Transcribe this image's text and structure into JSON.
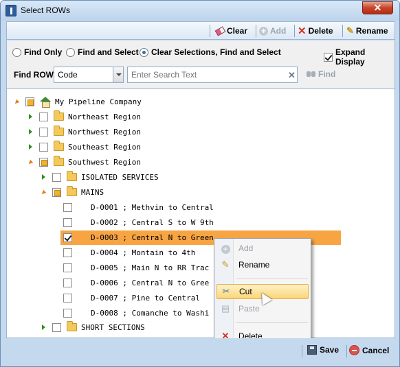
{
  "window": {
    "title": "Select ROWs",
    "close_glyph": "✕"
  },
  "toolbar": {
    "items": [
      {
        "label": "Clear",
        "icon": "eraser-icon",
        "enabled": true
      },
      {
        "label": "Add",
        "icon": "add-icon",
        "enabled": false
      },
      {
        "label": "Delete",
        "icon": "delete-icon",
        "enabled": true
      },
      {
        "label": "Rename",
        "icon": "pencil-icon",
        "enabled": true
      }
    ]
  },
  "options": {
    "radios": [
      {
        "label": "Find Only",
        "selected": false
      },
      {
        "label": "Find and Select",
        "selected": false
      },
      {
        "label": "Clear Selections, Find and Select",
        "selected": true
      }
    ],
    "expand_display": {
      "label": "Expand Display",
      "checked": true
    },
    "find_row_label": "Find ROW",
    "find_field_value": "Code",
    "search_placeholder": "Enter Search Text",
    "find_button": "Find"
  },
  "tree": {
    "nodes": [
      {
        "label": "My Pipeline Company",
        "level": 0,
        "state": "expanded",
        "icon": "home-icon",
        "check": "partial"
      },
      {
        "label": "Northeast Region",
        "level": 1,
        "state": "collapsed",
        "icon": "folder-icon",
        "check": "none"
      },
      {
        "label": "Northwest Region",
        "level": 1,
        "state": "collapsed",
        "icon": "folder-icon",
        "check": "none"
      },
      {
        "label": "Southeast Region",
        "level": 1,
        "state": "collapsed",
        "icon": "folder-icon",
        "check": "none"
      },
      {
        "label": "Southwest Region",
        "level": 1,
        "state": "expanded",
        "icon": "folder-icon",
        "check": "partial"
      },
      {
        "label": "ISOLATED SERVICES",
        "level": 2,
        "state": "collapsed",
        "icon": "folder-icon",
        "check": "none"
      },
      {
        "label": "MAINS",
        "level": 2,
        "state": "expanded",
        "icon": "folder-icon",
        "check": "partial"
      },
      {
        "label": "D-0001 ; Methvin to Central",
        "level": 3,
        "state": "leaf",
        "check": "none"
      },
      {
        "label": "D-0002 ; Central S to W 9th",
        "level": 3,
        "state": "leaf",
        "check": "none"
      },
      {
        "label": "D-0003 ; Central N  to Green",
        "level": 3,
        "state": "leaf",
        "check": "checked",
        "selected": true
      },
      {
        "label": "D-0004 ; Montain to 4th",
        "level": 3,
        "state": "leaf",
        "check": "none"
      },
      {
        "label": "D-0005 ; Main N to RR Trac",
        "level": 3,
        "state": "leaf",
        "check": "none"
      },
      {
        "label": "D-0006 ; Central N to Gree",
        "level": 3,
        "state": "leaf",
        "check": "none"
      },
      {
        "label": "D-0007 ; Pine to Central",
        "level": 3,
        "state": "leaf",
        "check": "none"
      },
      {
        "label": "D-0008 ; Comanche to Washi",
        "level": 3,
        "state": "leaf",
        "check": "none"
      },
      {
        "label": "SHORT SECTIONS",
        "level": 2,
        "state": "collapsed",
        "icon": "folder-icon",
        "check": "none"
      }
    ]
  },
  "context_menu": {
    "items": [
      {
        "label": "Add",
        "icon": "add-icon",
        "enabled": false
      },
      {
        "label": "Rename",
        "icon": "pencil-icon",
        "enabled": true
      },
      {
        "label": "Cut",
        "icon": "scissors-icon",
        "enabled": true,
        "hover": true
      },
      {
        "label": "Paste",
        "icon": "paste-icon",
        "enabled": false
      },
      {
        "label": "Delete",
        "icon": "delete-icon",
        "enabled": true
      }
    ]
  },
  "footer": {
    "save_label": "Save",
    "cancel_label": "Cancel"
  }
}
